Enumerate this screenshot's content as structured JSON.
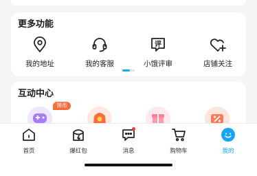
{
  "more_features": {
    "title": "更多功能",
    "items": [
      {
        "label": "我的地址",
        "icon": "location-pin-icon"
      },
      {
        "label": "我的客服",
        "icon": "headset-icon"
      },
      {
        "label": "小饿评审",
        "icon": "review-chat-icon",
        "glyph": "评"
      },
      {
        "label": "店铺关注",
        "icon": "heart-plus-icon"
      }
    ],
    "pager": {
      "pages": 2,
      "current": 1
    }
  },
  "interaction_center": {
    "title": "互动中心",
    "badge": "领币",
    "items": [
      {
        "icon": "game-controller-icon",
        "color": "#a87cf5"
      },
      {
        "icon": "red-envelope-icon",
        "color": "#ff6a3d"
      },
      {
        "icon": "gift-icon",
        "color": "#ff9aa8"
      },
      {
        "icon": "coupon-icon",
        "color": "#ff7a5a"
      }
    ]
  },
  "tabbar": {
    "items": [
      {
        "label": "首页",
        "icon": "home-icon",
        "active": false
      },
      {
        "label": "爆红包",
        "icon": "red-packet-icon",
        "active": false
      },
      {
        "label": "消息",
        "icon": "message-icon",
        "active": false,
        "has_dot": true
      },
      {
        "label": "购物车",
        "icon": "cart-icon",
        "active": false
      },
      {
        "label": "我的",
        "icon": "profile-icon",
        "active": true
      }
    ],
    "accent": "#16a6f5"
  }
}
